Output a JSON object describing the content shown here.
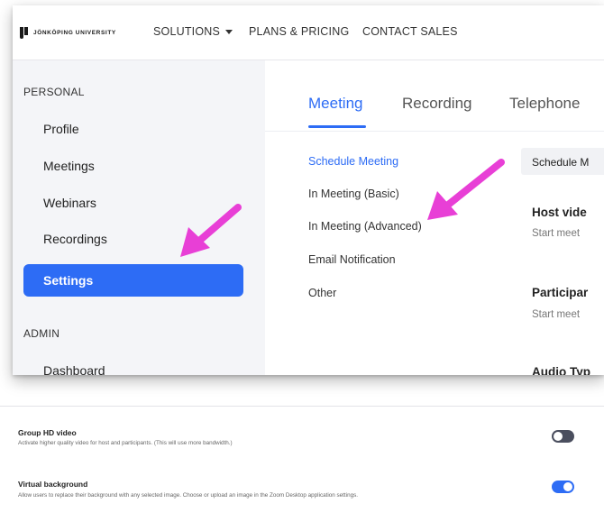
{
  "nav": {
    "logo_text": "JÖNKÖPING UNIVERSITY",
    "solutions": "SOLUTIONS",
    "plans": "PLANS & PRICING",
    "contact": "CONTACT SALES"
  },
  "sidebar": {
    "personal_label": "PERSONAL",
    "items": [
      "Profile",
      "Meetings",
      "Webinars",
      "Recordings",
      "Settings"
    ],
    "admin_label": "ADMIN",
    "admin_items": [
      "Dashboard"
    ]
  },
  "tabs": [
    "Meeting",
    "Recording",
    "Telephone"
  ],
  "subnav": [
    "Schedule Meeting",
    "In Meeting (Basic)",
    "In Meeting (Advanced)",
    "Email Notification",
    "Other"
  ],
  "content": {
    "chip": "Schedule M",
    "host_video": "Host vide",
    "host_video_desc": "Start meet",
    "participants": "Participar",
    "participants_desc": "Start meet",
    "audio_type": "Audio Typ"
  },
  "settings": [
    {
      "title": "Group HD video",
      "desc": "Activate higher quality video for host and participants. (This will use more bandwidth.)",
      "enabled": false
    },
    {
      "title": "Virtual background",
      "desc": "Allow users to replace their background with any selected image. Choose or upload an image in the Zoom Desktop application settings.",
      "enabled": true
    }
  ],
  "colors": {
    "accent": "#2d6cf5",
    "arrow": "#e83fd6",
    "toggle_off": "#4a4e5e"
  }
}
